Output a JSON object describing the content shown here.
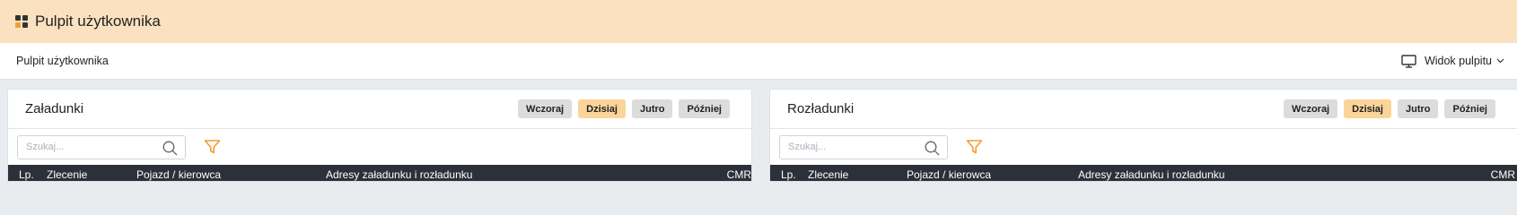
{
  "header": {
    "title": "Pulpit użytkownika"
  },
  "breadcrumb": {
    "current": "Pulpit użytkownika"
  },
  "view_switch": {
    "label": "Widok pulpitu",
    "icon": "monitor-icon"
  },
  "panels": {
    "left": {
      "title": "Załadunki",
      "buttons": [
        "Wczoraj",
        "Dzisiaj",
        "Jutro",
        "Później"
      ],
      "active_button": "Dzisiaj",
      "search_placeholder": "Szukaj...",
      "columns": [
        "Lp.",
        "Zlecenie",
        "Pojazd / kierowca",
        "Adresy załadunku i rozładunku",
        "CMR"
      ]
    },
    "right": {
      "title": "Rozładunki",
      "buttons": [
        "Wczoraj",
        "Dzisiaj",
        "Jutro",
        "Później"
      ],
      "active_button": "Dzisiaj",
      "search_placeholder": "Szukaj...",
      "columns": [
        "Lp.",
        "Zlecenie",
        "Pojazd / kierowca",
        "Adresy załadunku i rozładunku",
        "CMR"
      ]
    }
  },
  "colors": {
    "header_bg": "#fbe1c0",
    "active_button": "#fbd49a",
    "button": "#dcdcdc",
    "table_header": "#2c3038",
    "accent": "#f0a030"
  }
}
